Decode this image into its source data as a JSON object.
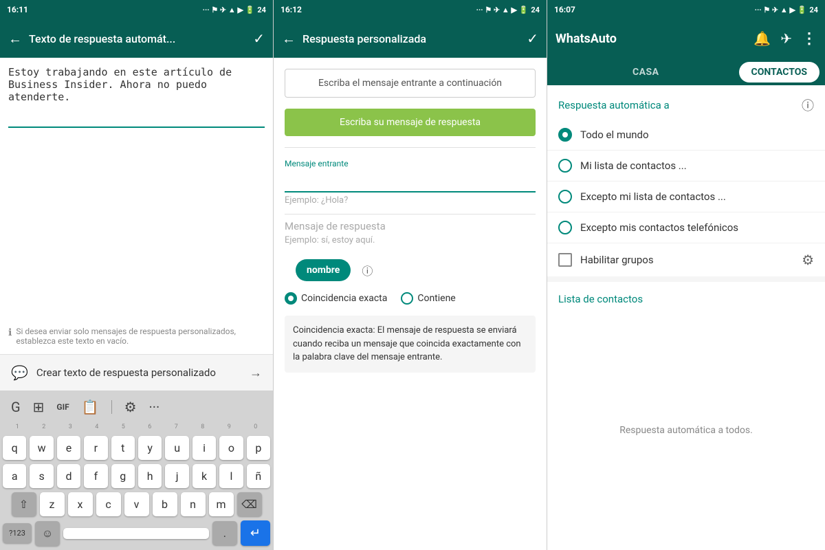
{
  "panel1": {
    "status_time": "16:11",
    "status_icons": "···  ⚡ 📶 🔋 24",
    "app_bar": {
      "back_icon": "←",
      "title": "Texto de respuesta automát...",
      "check_icon": "✓"
    },
    "textarea_content": "Estoy trabajando en este artículo de Business Insider. Ahora no puedo atenderte.",
    "hint_text": "Si desea enviar solo mensajes de respuesta personalizados, establezca este texto en vacío.",
    "create_btn_text": "Crear texto de respuesta personalizado",
    "keyboard": {
      "row_numbers": [
        "1",
        "2",
        "3",
        "4",
        "5",
        "6",
        "7",
        "8",
        "9",
        "0"
      ],
      "row1": [
        "q",
        "w",
        "e",
        "r",
        "t",
        "y",
        "u",
        "i",
        "o",
        "p"
      ],
      "row2": [
        "a",
        "s",
        "d",
        "f",
        "g",
        "h",
        "j",
        "k",
        "l",
        "ñ"
      ],
      "row3_shift": "⇧",
      "row3": [
        "z",
        "x",
        "c",
        "v",
        "b",
        "n",
        "m"
      ],
      "row3_del": "⌫",
      "row4_sym": "?123",
      "row4_emoji": "☺",
      "row4_space": "",
      "row4_dot": ".",
      "row4_enter": "↵"
    }
  },
  "panel2": {
    "status_time": "16:12",
    "status_icons": "···  ⚡ 📶 🔋 24",
    "app_bar": {
      "back_icon": "←",
      "title": "Respuesta personalizada",
      "check_icon": "✓"
    },
    "incoming_btn": "Escriba el mensaje entrante a continuación",
    "response_btn": "Escriba su mensaje de respuesta",
    "incoming_label": "Mensaje entrante",
    "incoming_placeholder": "Ejemplo: ¿Hola?",
    "response_label": "Mensaje de respuesta",
    "response_placeholder": "Ejemplo: sí, estoy aquí.",
    "nombre_btn": "nombre",
    "match_exact": "Coincidencia exacta",
    "match_contains": "Contiene",
    "info_box": "Coincidencia exacta: El mensaje de respuesta se enviará cuando reciba un mensaje que coincida exactamente con la palabra clave del mensaje entrante."
  },
  "panel3": {
    "status_time": "16:07",
    "status_icons": "···  ⚡ 📶 🔋 24",
    "app_bar": {
      "title": "WhatsAuto",
      "bell_icon": "🔔",
      "send_icon": "✈",
      "menu_icon": "⋮"
    },
    "tab_casa": "CASA",
    "tab_contactos": "CONTACTOS",
    "section_title": "Respuesta automática a",
    "options": [
      {
        "label": "Todo el mundo",
        "selected": true,
        "type": "radio"
      },
      {
        "label": "Mi lista de contactos ...",
        "selected": false,
        "type": "radio"
      },
      {
        "label": "Excepto mi lista de contactos ...",
        "selected": false,
        "type": "radio"
      },
      {
        "label": "Excepto mis contactos telefónicos",
        "selected": false,
        "type": "radio"
      },
      {
        "label": "Habilitar grupos",
        "selected": false,
        "type": "checkbox"
      }
    ],
    "contact_list_title": "Lista de contactos",
    "empty_text": "Respuesta automática a todos."
  }
}
